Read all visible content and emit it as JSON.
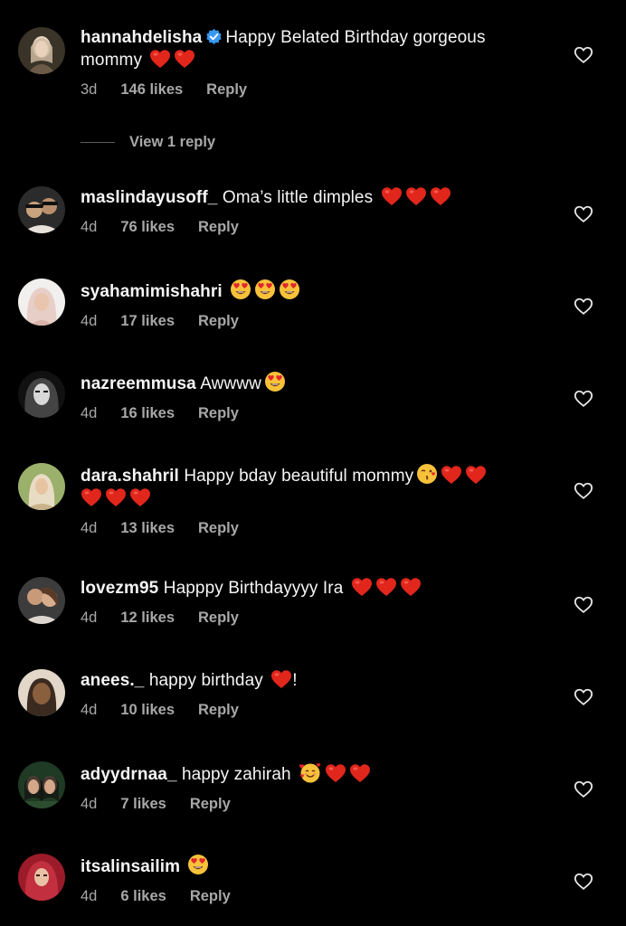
{
  "comments": [
    {
      "username": "hannahdelisha",
      "verified": true,
      "text": "Happy Belated Birthday gorgeous mommy",
      "emojis": [
        "red-heart",
        "red-heart"
      ],
      "time": "3d",
      "likes": "146 likes",
      "reply": "Reply",
      "avatar_colors": [
        "#3a3328",
        "#e8d8c4",
        "#6b5a48"
      ]
    },
    {
      "username": "maslindayusoff_",
      "verified": false,
      "text": "Oma’s little dimples",
      "emojis": [
        "red-heart",
        "red-heart",
        "red-heart"
      ],
      "time": "4d",
      "likes": "76 likes",
      "reply": "Reply",
      "avatar_colors": [
        "#2b2b2b",
        "#c9a27e",
        "#e8e2da"
      ]
    },
    {
      "username": "syahamimishahri",
      "verified": false,
      "text": "",
      "emojis": [
        "heart-eyes",
        "heart-eyes",
        "heart-eyes"
      ],
      "time": "4d",
      "likes": "17 likes",
      "reply": "Reply",
      "avatar_colors": [
        "#f2f0ee",
        "#e7cfc8",
        "#d9b3a7"
      ]
    },
    {
      "username": "nazreemmusa",
      "verified": false,
      "text": "Awwww",
      "emojis": [
        "heart-eyes"
      ],
      "time": "4d",
      "likes": "16 likes",
      "reply": "Reply",
      "avatar_colors": [
        "#111111",
        "#d8d8d8",
        "#444444"
      ]
    },
    {
      "username": "dara.shahril",
      "verified": false,
      "text": "Happy bday beautiful mommy",
      "emojis": [
        "kiss-face",
        "red-heart",
        "red-heart",
        "red-heart",
        "red-heart",
        "red-heart"
      ],
      "time": "4d",
      "likes": "13 likes",
      "reply": "Reply",
      "avatar_colors": [
        "#9bb06a",
        "#e9dcc5",
        "#c7b28a"
      ]
    },
    {
      "username": "lovezm95",
      "verified": false,
      "text": "Happpy Birthdayyyy Ira",
      "emojis": [
        "red-heart",
        "red-heart",
        "red-heart"
      ],
      "time": "4d",
      "likes": "12 likes",
      "reply": "Reply",
      "avatar_colors": [
        "#3c3c3c",
        "#c99a79",
        "#ddd6cf"
      ]
    },
    {
      "username": "anees._",
      "verified": false,
      "text": "happy birthday",
      "emojis": [
        "red-heart"
      ],
      "suffix": "!",
      "time": "4d",
      "likes": "10 likes",
      "reply": "Reply",
      "avatar_colors": [
        "#e2d7c8",
        "#8a5f3e",
        "#3a2a20"
      ]
    },
    {
      "username": "adyydrnaa_",
      "verified": false,
      "text": "happy zahirah",
      "emojis": [
        "smiling-hearts",
        "red-heart",
        "red-heart"
      ],
      "time": "4d",
      "likes": "7 likes",
      "reply": "Reply",
      "avatar_colors": [
        "#1f3a24",
        "#c79a7c",
        "#2c4e2f"
      ]
    },
    {
      "username": "itsalinsailim",
      "verified": false,
      "text": "",
      "emojis": [
        "heart-eyes"
      ],
      "time": "4d",
      "likes": "6 likes",
      "reply": "Reply",
      "avatar_colors": [
        "#9b1b2a",
        "#e7c2a5",
        "#c22f3e"
      ]
    }
  ],
  "view_replies": "View 1 reply"
}
